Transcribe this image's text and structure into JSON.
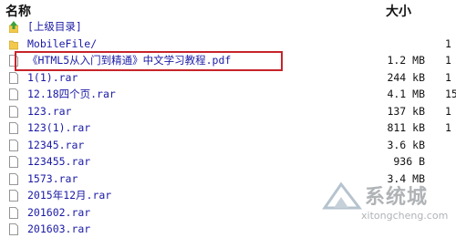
{
  "header": {
    "name_col": "名称",
    "size_col": "大小"
  },
  "rows": [
    {
      "type": "up",
      "name": "[上级目录]",
      "size": "",
      "date": ""
    },
    {
      "type": "folder",
      "name": "MobileFile/",
      "size": "",
      "date": "1"
    },
    {
      "type": "file",
      "name": "《HTML5从入门到精通》中文学习教程.pdf",
      "size": "1.2 MB",
      "date": "1"
    },
    {
      "type": "file",
      "name": "1(1).rar",
      "size": "244 kB",
      "date": "1"
    },
    {
      "type": "file",
      "name": "12.18四个页.rar",
      "size": "4.1 MB",
      "date": "15"
    },
    {
      "type": "file",
      "name": "123.rar",
      "size": "137 kB",
      "date": "1"
    },
    {
      "type": "file",
      "name": "123(1).rar",
      "size": "811 kB",
      "date": "1"
    },
    {
      "type": "file",
      "name": "12345.rar",
      "size": "3.6 kB",
      "date": ""
    },
    {
      "type": "file",
      "name": "123455.rar",
      "size": "936 B",
      "date": ""
    },
    {
      "type": "file",
      "name": "1573.rar",
      "size": "3.4 MB",
      "date": ""
    },
    {
      "type": "file",
      "name": "2015年12月.rar",
      "size": "",
      "date": ""
    },
    {
      "type": "file",
      "name": "201602.rar",
      "size": "",
      "date": ""
    },
    {
      "type": "file",
      "name": "201603.rar",
      "size": "",
      "date": ""
    }
  ],
  "watermark": {
    "text": "系统城",
    "url": "xitongcheng.com"
  },
  "colors": {
    "link": "#1a1aa6",
    "highlight": "#c6242a",
    "folder": "#f2c94c"
  }
}
